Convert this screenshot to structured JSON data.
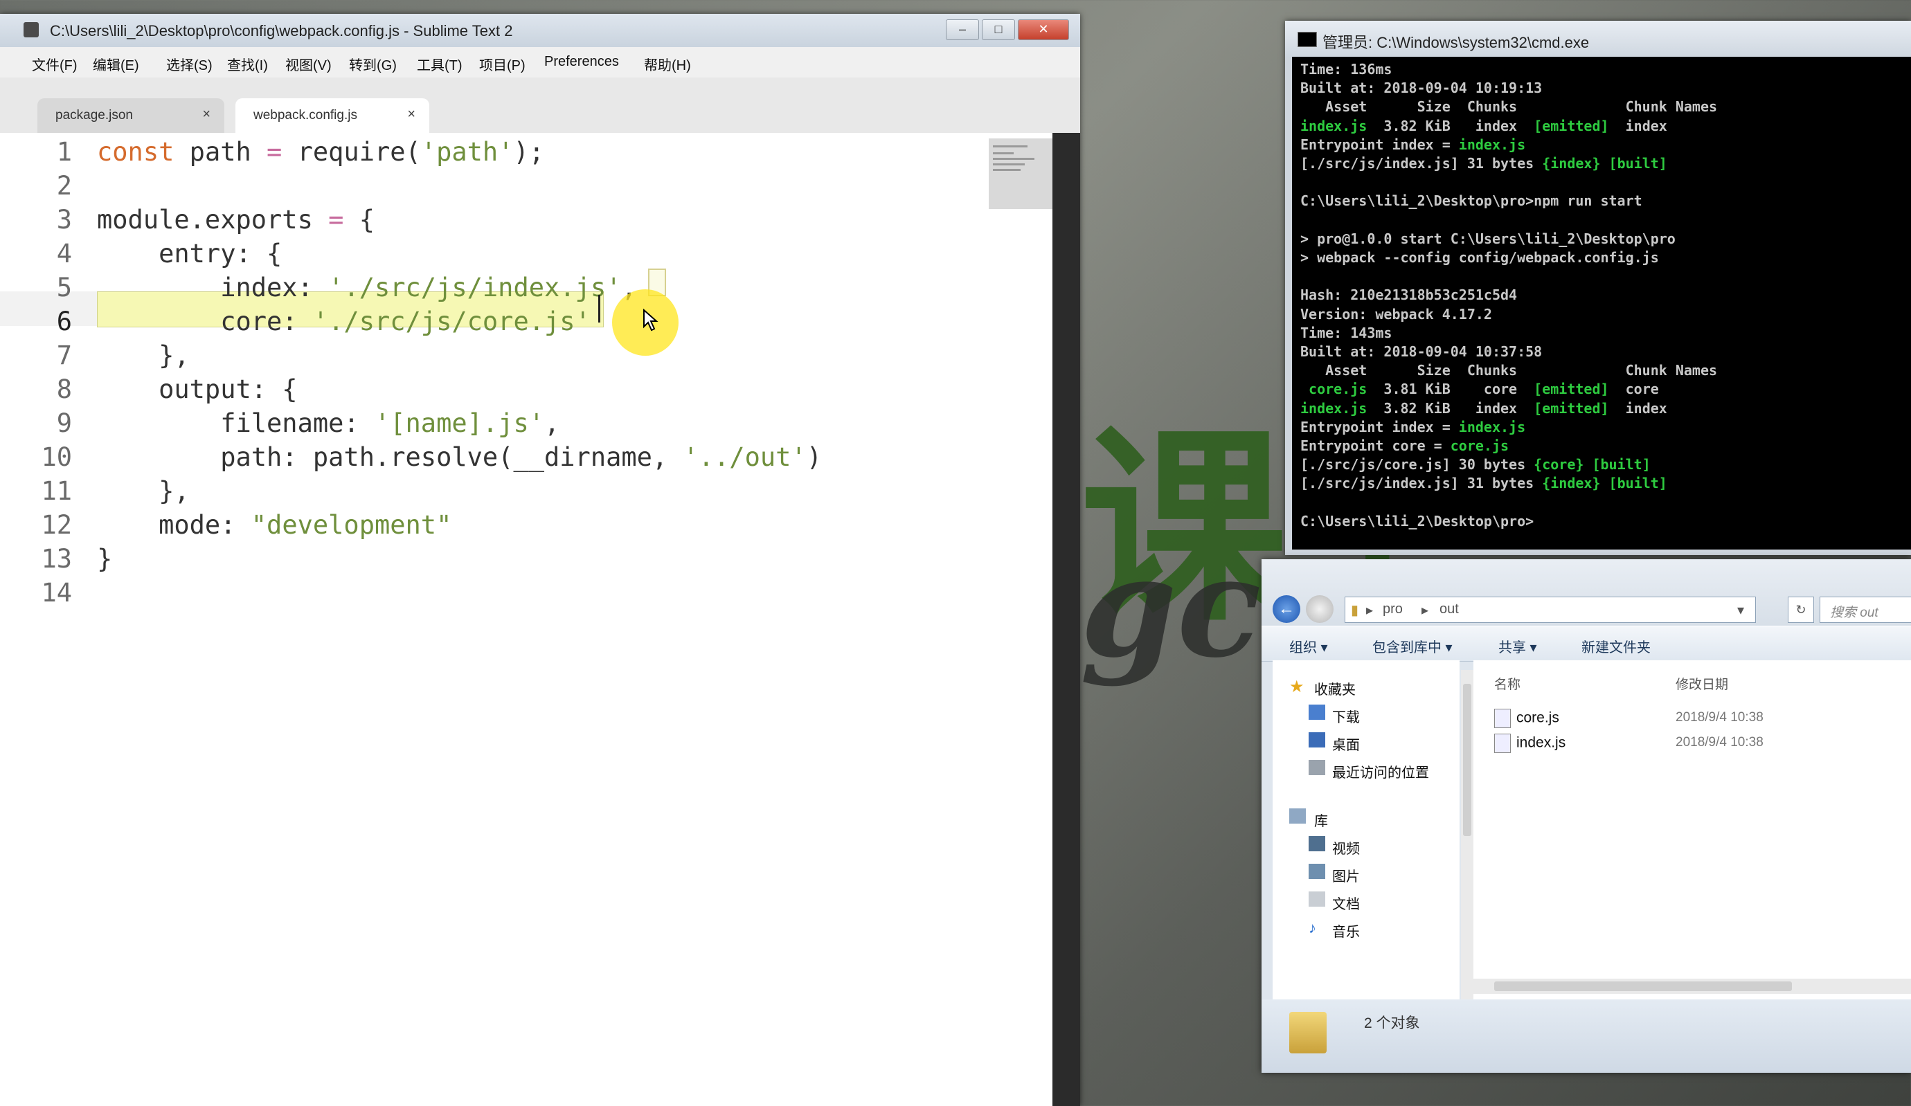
{
  "watermark": {
    "big": "课工",
    "sub": "gc"
  },
  "sublime": {
    "title": "C:\\Users\\lili_2\\Desktop\\pro\\config\\webpack.config.js - Sublime Text 2",
    "menu": [
      "文件(F)",
      "编辑(E)",
      "选择(S)",
      "查找(I)",
      "视图(V)",
      "转到(G)",
      "工具(T)",
      "项目(P)",
      "Preferences",
      "帮助(H)"
    ],
    "tabs": [
      {
        "label": "package.json",
        "close": "×"
      },
      {
        "label": "webpack.config.js",
        "close": "×"
      }
    ],
    "line_numbers": [
      "1",
      "2",
      "3",
      "4",
      "5",
      "6",
      "7",
      "8",
      "9",
      "10",
      "11",
      "12",
      "13",
      "14"
    ],
    "current_line": "6",
    "code": [
      "const path = require('path');",
      "",
      "module.exports = {",
      "    entry: {",
      "        index: './src/js/index.js',",
      "        core: './src/js/core.js'",
      "    },",
      "    output: {",
      "        filename: '[name].js',",
      "        path: path.resolve(__dirname, '../out')",
      "    },",
      "    mode: \"development\"",
      "}",
      ""
    ]
  },
  "cmd": {
    "title": "管理员: C:\\Windows\\system32\\cmd.exe",
    "lines": [
      {
        "t": "Time: 136ms",
        "c": ""
      },
      {
        "t": "Built at: 2018-09-04 10:19:13",
        "c": ""
      },
      {
        "t": "   Asset      Size  Chunks             Chunk Names",
        "c": ""
      },
      {
        "t": "index.js  3.82 KiB   index  [emitted]  index",
        "c": "mix1"
      },
      {
        "t": "Entrypoint index = index.js",
        "c": "mix2"
      },
      {
        "t": "[./src/js/index.js] 31 bytes {index} [built]",
        "c": "mix3"
      },
      {
        "t": "",
        "c": ""
      },
      {
        "t": "C:\\Users\\lili_2\\Desktop\\pro>npm run start",
        "c": ""
      },
      {
        "t": "",
        "c": ""
      },
      {
        "t": "> pro@1.0.0 start C:\\Users\\lili_2\\Desktop\\pro",
        "c": ""
      },
      {
        "t": "> webpack --config config/webpack.config.js",
        "c": ""
      },
      {
        "t": "",
        "c": ""
      },
      {
        "t": "Hash: 210e21318b53c251c5d4",
        "c": ""
      },
      {
        "t": "Version: webpack 4.17.2",
        "c": ""
      },
      {
        "t": "Time: 143ms",
        "c": ""
      },
      {
        "t": "Built at: 2018-09-04 10:37:58",
        "c": ""
      },
      {
        "t": "   Asset      Size  Chunks             Chunk Names",
        "c": ""
      },
      {
        "t": " core.js  3.81 KiB    core  [emitted]  core",
        "c": "mix1"
      },
      {
        "t": "index.js  3.82 KiB   index  [emitted]  index",
        "c": "mix1"
      },
      {
        "t": "Entrypoint index = index.js",
        "c": "mix2"
      },
      {
        "t": "Entrypoint core = core.js",
        "c": "mix2"
      },
      {
        "t": "[./src/js/core.js] 30 bytes {core} [built]",
        "c": "mix3"
      },
      {
        "t": "[./src/js/index.js] 31 bytes {index} [built]",
        "c": "mix3"
      },
      {
        "t": "",
        "c": ""
      },
      {
        "t": "C:\\Users\\lili_2\\Desktop\\pro>",
        "c": ""
      }
    ]
  },
  "explorer": {
    "path": [
      "pro",
      "out"
    ],
    "search_placeholder": "搜索 out",
    "toolbar": [
      "组织 ▾",
      "包含到库中 ▾",
      "共享 ▾",
      "新建文件夹"
    ],
    "nav_favorites": "收藏夹",
    "nav_fav_items": [
      "下载",
      "桌面",
      "最近访问的位置"
    ],
    "nav_library": "库",
    "nav_lib_items": [
      "视频",
      "图片",
      "文档",
      "音乐"
    ],
    "col_name": "名称",
    "col_date": "修改日期",
    "files": [
      {
        "name": "core.js",
        "date": "2018/9/4 10:38"
      },
      {
        "name": "index.js",
        "date": "2018/9/4 10:38"
      }
    ],
    "status": "2 个对象"
  },
  "colors": {
    "keyword": "#d56b2d",
    "string": "#6f8f3c",
    "console_green": "#2ecc40"
  }
}
